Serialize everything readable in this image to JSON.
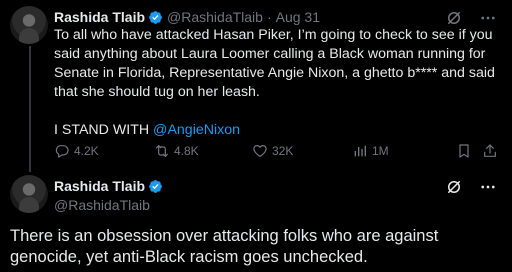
{
  "tweet1": {
    "name": "Rashida Tlaib",
    "handle": "@RashidaTlaib",
    "separator": "·",
    "time": "Aug 31",
    "body_line1": "To all who have attacked Hasan Piker, I’m going to check to see if you said anything about Laura Loomer calling a Black woman running for Senate in Florida, Representative Angie Nixon, a ghetto b**** and said that she should tug on her leash.",
    "stand_prefix": "I STAND WITH ",
    "stand_mention": "@AngieNixon",
    "stats": {
      "replies": "4.2K",
      "reposts": "4.8K",
      "likes": "32K",
      "views": "1M"
    }
  },
  "tweet2": {
    "name": "Rashida Tlaib",
    "handle": "@RashidaTlaib",
    "body": "There is an obsession over attacking folks who are against genocide, yet anti-Black racism goes unchecked."
  },
  "colors": {
    "background": "#000000",
    "text": "#e7e9ea",
    "muted": "#71767b",
    "accent": "#1d9bf0"
  },
  "icons": {
    "verified": "verified-badge-icon",
    "grok": "grok-icon",
    "more": "more-icon",
    "reply": "reply-icon",
    "repost": "repost-icon",
    "like": "like-icon",
    "views": "views-icon",
    "bookmark": "bookmark-icon",
    "share": "share-icon"
  }
}
